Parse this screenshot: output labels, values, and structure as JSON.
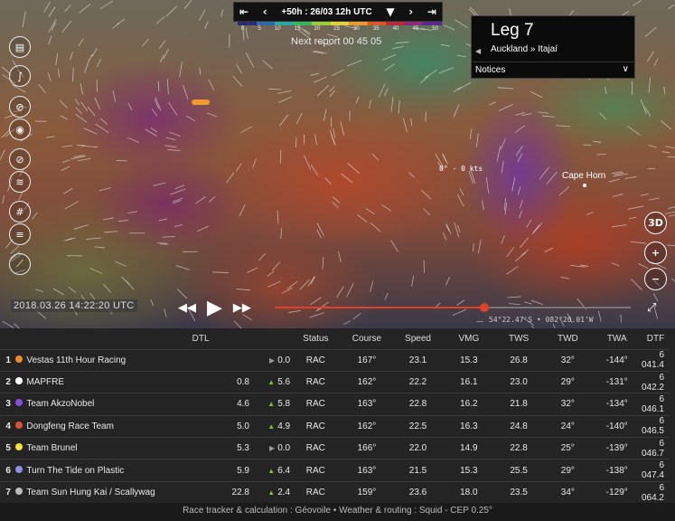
{
  "player": {
    "time_label": "+50h : 26/03 12h UTC",
    "next_report": "Next report 00 45 05",
    "timestamp": "2018.03.26 14:22:20 UTC",
    "coordinates": "54°22.47'S • 082°20.01'W",
    "progress": 0.59
  },
  "wind_scale": {
    "labels": [
      "0",
      "5",
      "10",
      "15",
      "20",
      "25",
      "30",
      "35",
      "40",
      "45",
      "50"
    ],
    "colors": [
      "#2b2b6e",
      "#2c6aa8",
      "#2ea6a6",
      "#38b45a",
      "#9ccb3a",
      "#e0d13a",
      "#e89a2c",
      "#d8562a",
      "#b82a3a",
      "#8a2a7a",
      "#5a2a8a"
    ]
  },
  "leg": {
    "title": "Leg 7",
    "route": "Auckland » Itajaí",
    "notices": "Notices"
  },
  "map_labels": {
    "cape_horn": "Cape Horn",
    "wind_readout": "0° - 0 kts"
  },
  "right_tools": {
    "view_3d": "3D"
  },
  "table": {
    "headers": {
      "dtl": "DTL",
      "status": "Status",
      "course": "Course",
      "speed": "Speed",
      "vmg": "VMG",
      "tws": "TWS",
      "twd": "TWD",
      "twa": "TWA",
      "dtf": "DTF"
    },
    "rows": [
      {
        "rank": "1",
        "color": "#f08a24",
        "team": "Vestas 11th Hour Racing",
        "dtl": "",
        "trend": "flat",
        "delta": "0.0",
        "status": "RAC",
        "course": "167°",
        "speed": "23.1",
        "vmg": "15.3",
        "tws": "26.8",
        "twd": "32°",
        "twa": "-144°",
        "dtf": "6 041.4"
      },
      {
        "rank": "2",
        "color": "#ffffff",
        "team": "MAPFRE",
        "dtl": "0.8",
        "trend": "up",
        "delta": "5.6",
        "status": "RAC",
        "course": "162°",
        "speed": "22.2",
        "vmg": "16.1",
        "tws": "23.0",
        "twd": "29°",
        "twa": "-131°",
        "dtf": "6 042.2"
      },
      {
        "rank": "3",
        "color": "#8a4de0",
        "team": "Team AkzoNobel",
        "dtl": "4.6",
        "trend": "up",
        "delta": "5.8",
        "status": "RAC",
        "course": "163°",
        "speed": "22.8",
        "vmg": "16.2",
        "tws": "21.8",
        "twd": "32°",
        "twa": "-134°",
        "dtf": "6 046.1"
      },
      {
        "rank": "4",
        "color": "#d9533a",
        "team": "Dongfeng Race Team",
        "dtl": "5.0",
        "trend": "up",
        "delta": "4.9",
        "status": "RAC",
        "course": "162°",
        "speed": "22.5",
        "vmg": "16.3",
        "tws": "24.8",
        "twd": "24°",
        "twa": "-140°",
        "dtf": "6 046.5"
      },
      {
        "rank": "5",
        "color": "#f5e33a",
        "team": "Team Brunel",
        "dtl": "5.3",
        "trend": "flat",
        "delta": "0.0",
        "status": "RAC",
        "course": "166°",
        "speed": "22.0",
        "vmg": "14.9",
        "tws": "22.8",
        "twd": "25°",
        "twa": "-139°",
        "dtf": "6 046.7"
      },
      {
        "rank": "6",
        "color": "#8d8fe6",
        "team": "Turn The Tide on Plastic",
        "dtl": "5.9",
        "trend": "up",
        "delta": "6.4",
        "status": "RAC",
        "course": "163°",
        "speed": "21.5",
        "vmg": "15.3",
        "tws": "25.5",
        "twd": "29°",
        "twa": "-138°",
        "dtf": "6 047.4"
      },
      {
        "rank": "7",
        "color": "#bbbbbb",
        "team": "Team Sun Hung Kai / Scallywag",
        "dtl": "22.8",
        "trend": "up",
        "delta": "2.4",
        "status": "RAC",
        "course": "159°",
        "speed": "23.6",
        "vmg": "18.0",
        "tws": "23.5",
        "twd": "34°",
        "twa": "-129°",
        "dtf": "6 064.2"
      }
    ]
  },
  "footer": "Race tracker & calculation : Géovoile • Weather & routing : Squid - CEP 0.25°"
}
